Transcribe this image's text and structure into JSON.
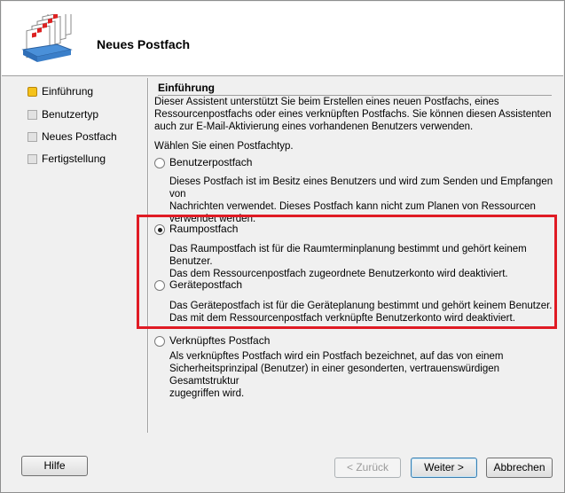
{
  "header": {
    "title": "Neues Postfach",
    "icon": "mailbox-stack-icon"
  },
  "steps": [
    {
      "label": "Einführung",
      "active": true
    },
    {
      "label": "Benutzertyp",
      "active": false
    },
    {
      "label": "Neues Postfach",
      "active": false
    },
    {
      "label": "Fertigstellung",
      "active": false
    }
  ],
  "content": {
    "section_title": "Einführung",
    "intro_lines": [
      "Dieser Assistent unterstützt Sie beim Erstellen eines neuen Postfachs, eines",
      "Ressourcenpostfachs oder eines verknüpften Postfachs. Sie können diesen Assistenten",
      "auch zur E-Mail-Aktivierung eines vorhandenen Benutzers verwenden."
    ],
    "choose_label": "Wählen Sie einen Postfachtyp.",
    "options": [
      {
        "label": "Benutzerpostfach",
        "checked": false,
        "description": [
          "Dieses Postfach ist im Besitz eines Benutzers und wird zum Senden und Empfangen von",
          "Nachrichten verwendet. Dieses Postfach kann nicht zum Planen von Ressourcen",
          "verwendet werden."
        ]
      },
      {
        "label": "Raumpostfach",
        "checked": true,
        "description": [
          "Das Raumpostfach ist für die Raumterminplanung bestimmt und gehört keinem Benutzer.",
          "Das dem Ressourcenpostfach zugeordnete Benutzerkonto wird deaktiviert."
        ]
      },
      {
        "label": "Gerätepostfach",
        "checked": false,
        "description": [
          "Das Gerätepostfach ist für die Geräteplanung bestimmt und gehört keinem Benutzer.",
          "Das mit dem Ressourcenpostfach verknüpfte Benutzerkonto wird deaktiviert."
        ]
      },
      {
        "label": "Verknüpftes Postfach",
        "checked": false,
        "description": [
          "Als verknüpftes Postfach wird ein Postfach bezeichnet, auf das von einem",
          "Sicherheitsprinzipal (Benutzer) in einer gesonderten, vertrauenswürdigen Gesamtstruktur",
          "zugegriffen wird."
        ]
      }
    ]
  },
  "buttons": {
    "help": "Hilfe",
    "back": "< Zurück",
    "next": "Weiter >",
    "cancel": "Abbrechen"
  },
  "colors": {
    "highlight": "#e01b24",
    "active_step": "#f5c21a"
  }
}
